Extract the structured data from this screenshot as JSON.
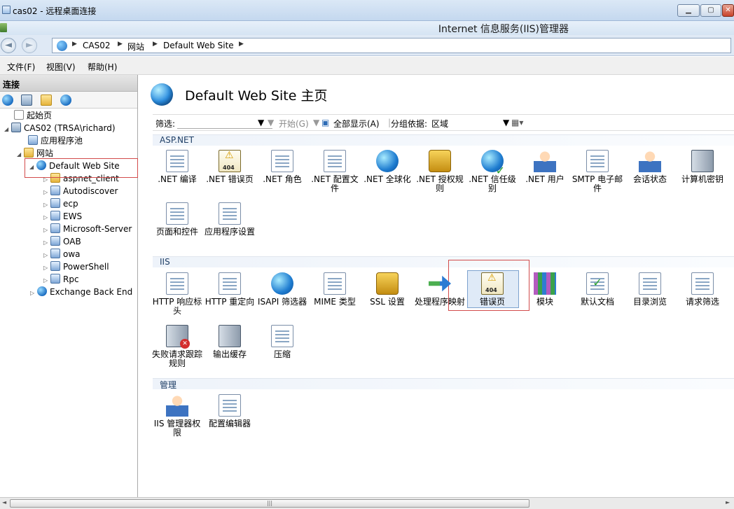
{
  "rdp": {
    "title": "cas02 - 远程桌面连接",
    "min": "▁",
    "max": "▢",
    "close": "✕"
  },
  "iis": {
    "title": "Internet 信息服务(IIS)管理器"
  },
  "address": {
    "crumbs": [
      "CAS02",
      "网站",
      "Default Web Site"
    ],
    "back": "◄",
    "forward": "►"
  },
  "menu": {
    "file": "文件(F)",
    "view": "视图(V)",
    "help": "帮助(H)"
  },
  "connections": {
    "header": "连接",
    "tree": [
      {
        "label": "起始页",
        "expander": ""
      },
      {
        "label": "CAS02 (TRSA\\richard)",
        "expander": "◢"
      },
      {
        "label": "应用程序池",
        "expander": ""
      },
      {
        "label": "网站",
        "expander": "◢"
      },
      {
        "label": "Default Web Site",
        "expander": "◢"
      },
      {
        "label": "aspnet_client",
        "expander": "▷"
      },
      {
        "label": "Autodiscover",
        "expander": "▷"
      },
      {
        "label": "ecp",
        "expander": "▷"
      },
      {
        "label": "EWS",
        "expander": "▷"
      },
      {
        "label": "Microsoft-Server",
        "expander": "▷"
      },
      {
        "label": "OAB",
        "expander": "▷"
      },
      {
        "label": "owa",
        "expander": "▷"
      },
      {
        "label": "PowerShell",
        "expander": "▷"
      },
      {
        "label": "Rpc",
        "expander": "▷"
      },
      {
        "label": "Exchange Back End",
        "expander": "▷"
      }
    ]
  },
  "main": {
    "title": "Default Web Site 主页",
    "filter_label": "筛选:",
    "start_label": "开始(G)",
    "show_all_label": "全部显示(A)",
    "group_label": "分组依据:",
    "group_value": "区域",
    "sections": {
      "aspnet": "ASP.NET",
      "iis": "IIS",
      "manage": "管理"
    },
    "aspnet_features": [
      ".NET 编译",
      ".NET 错误页",
      ".NET 角色",
      ".NET 配置文件",
      ".NET 全球化",
      ".NET 授权规则",
      ".NET 信任级别",
      ".NET 用户",
      "SMTP 电子邮件",
      "会话状态",
      "计算机密钥",
      "页面和控件",
      "应用程序设置"
    ],
    "iis_features": [
      "HTTP 响应标头",
      "HTTP 重定向",
      "ISAPI 筛选器",
      "MIME 类型",
      "SSL 设置",
      "处理程序映射",
      "错误页",
      "模块",
      "默认文档",
      "目录浏览",
      "请求筛选",
      "失败请求跟踪规则",
      "输出缓存",
      "压缩"
    ],
    "manage_features": [
      "IIS 管理器权限",
      "配置编辑器"
    ]
  },
  "scroll": {
    "grip": "|||",
    "left": "◄",
    "right": "►"
  }
}
